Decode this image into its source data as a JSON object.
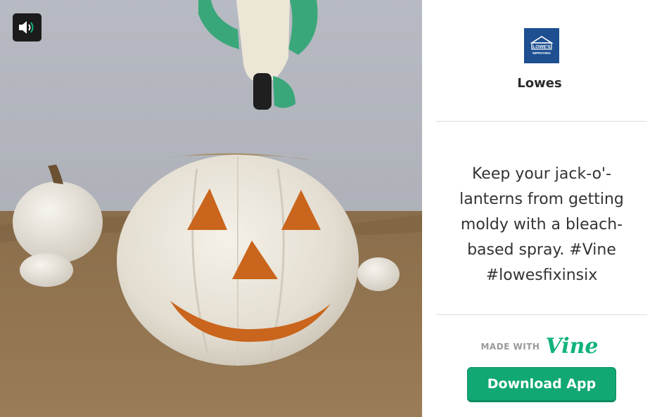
{
  "video": {
    "sound_icon": "speaker-on-icon"
  },
  "author": {
    "name": "Lowes",
    "avatar_text_line1": "LOWE'S",
    "avatar_text_line2": "IMPROVING",
    "avatar_color": "#1d4f91"
  },
  "post": {
    "caption": "Keep your jack-o'-lanterns from getting moldy with a bleach-based spray. #Vine #lowesfixinsix"
  },
  "footer": {
    "made_with_label": "MADE WITH",
    "brand_logo": "Vine",
    "brand_color": "#11b27c",
    "download_label": "Download App"
  }
}
